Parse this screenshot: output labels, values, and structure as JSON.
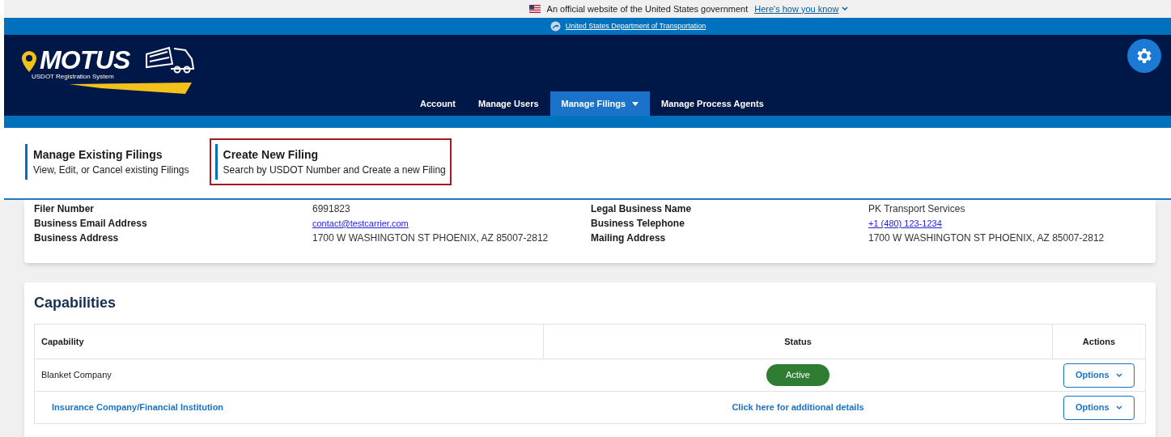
{
  "gov_banner": {
    "text": "An official website of the United States government",
    "link": "Here's how you know"
  },
  "agency_bar": {
    "link": "United States Department of Transportation"
  },
  "logo": {
    "name": "MOTUS",
    "tagline": "USDOT Registration System"
  },
  "nav": [
    {
      "label": "Account",
      "selected": false,
      "dropdown": false
    },
    {
      "label": "Manage Users",
      "selected": false,
      "dropdown": false
    },
    {
      "label": "Manage Filings",
      "selected": true,
      "dropdown": true
    },
    {
      "label": "Manage Process Agents",
      "selected": false,
      "dropdown": false
    }
  ],
  "dropdown_menu": [
    {
      "title": "Manage Existing Filings",
      "description": "View, Edit, or Cancel existing Filings",
      "highlighted": false
    },
    {
      "title": "Create New Filing",
      "description": "Search by USDOT Number and Create a new Filing",
      "highlighted": true
    }
  ],
  "details": [
    {
      "label": "Filer Number",
      "value": "6991823",
      "kind": "text"
    },
    {
      "label": "Legal Business Name",
      "value": "PK Transport Services",
      "kind": "text"
    },
    {
      "label": "Business Email Address",
      "value": "contact@testcarrier.com",
      "kind": "link"
    },
    {
      "label": "Business Telephone",
      "value": "+1 (480) 123-1234",
      "kind": "link"
    },
    {
      "label": "Business Address",
      "value": "1700 W WASHINGTON ST PHOENIX, AZ 85007-2812",
      "kind": "text"
    },
    {
      "label": "Mailing Address",
      "value": "1700 W WASHINGTON ST PHOENIX, AZ 85007-2812",
      "kind": "text"
    }
  ],
  "capabilities": {
    "title": "Capabilities",
    "columns": [
      "Capability",
      "Status",
      "Actions"
    ],
    "rows": [
      {
        "capability": "Blanket Company",
        "status": "Active",
        "kind": "badge",
        "action": "Options"
      },
      {
        "capability": "Insurance Company/Financial Institution",
        "status": "Click here for additional details",
        "kind": "link",
        "action": "Options"
      }
    ]
  }
}
